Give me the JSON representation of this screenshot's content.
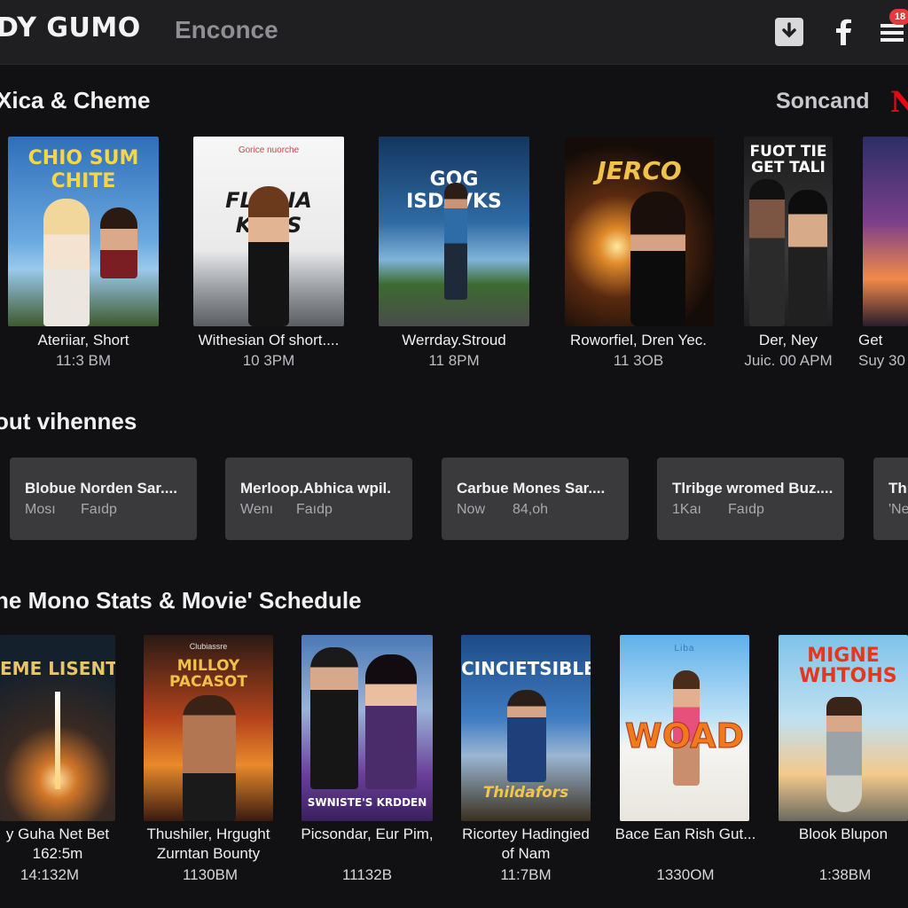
{
  "header": {
    "brand": "DY GUMO",
    "nav_link": "Enconce",
    "notification_count": "18"
  },
  "section1": {
    "title": "Xica & Cheme",
    "search_label": "Soncand",
    "brand_letter": "N",
    "movies": [
      {
        "poster_title": "CHIO SUM CHITE",
        "title": "Ateriiar, Short",
        "time": "11:3 BM"
      },
      {
        "poster_title": "FLADIA KUNS",
        "poster_tagline": "Gorice nuorche",
        "title": "Withesian Of short....",
        "time": "10 3PM"
      },
      {
        "poster_title": "GOG ISDAVKS",
        "title": "Werrday.Stroud",
        "time": "11 8PM"
      },
      {
        "poster_title": "JERCO",
        "title": "Roworfiel, Dren Yec.",
        "time": "11 3OB"
      },
      {
        "poster_title": "FUOT TIE GET TALI",
        "title": "Der, Ney",
        "time": "Juic. 00 APM"
      },
      {
        "poster_title": "",
        "title": "Get",
        "time": "Suy 30"
      }
    ]
  },
  "section2": {
    "title": "out vihennes",
    "cards": [
      {
        "title": "Blobue Norden Sar....",
        "meta1": "Mosı",
        "meta2": "Faıdp"
      },
      {
        "title": "Merloop.Abhica wpil.",
        "meta1": "Wenı",
        "meta2": "Faıdp"
      },
      {
        "title": "Carbue Mones Sar....",
        "meta1": "Now",
        "meta2": "84,oh"
      },
      {
        "title": "Tlribge wromed Buz....",
        "meta1": "1Kaı",
        "meta2": "Faıdp"
      },
      {
        "title": "Thı",
        "meta1": "'Ne",
        "meta2": ""
      }
    ]
  },
  "section3": {
    "title": "he Mono Stats & Movie' Schedule",
    "movies": [
      {
        "poster_title": "EME LISENTA",
        "line1": "y Guha Net Bet",
        "line2": "162:5m",
        "time": "14:132M"
      },
      {
        "poster_title": "MILLOY PACASOT",
        "poster_tagline": "Clubiassre",
        "line1": "Thushiler, Hrgught",
        "line2": "Zurntan Bounty",
        "time": "1130BM"
      },
      {
        "poster_title": "SWNISTE'S KRDDEN",
        "line1": "Picsondar, Eur Pim,",
        "line2": "",
        "time": "11132B"
      },
      {
        "poster_title": "CINCIETSIBLE",
        "poster_subtitle": "Thildafors",
        "line1": "Ricortey Hadingied",
        "line2": "of Nam",
        "time": "11:7BM"
      },
      {
        "poster_title": "WOAD",
        "poster_tagline": "Liba",
        "line1": "Bace Ean Rish Gut...",
        "line2": "",
        "time": "1330OM"
      },
      {
        "poster_title": "MIGNE WHTOHS",
        "line1": "Blook Blupon",
        "line2": "",
        "time": "1:38BM"
      }
    ]
  },
  "colors": {
    "background": "#111113",
    "header": "#1f1f22",
    "card": "#3a3a3d",
    "accent_red": "#e50914"
  },
  "icons": [
    "download-icon",
    "facebook-icon",
    "menu-icon"
  ]
}
